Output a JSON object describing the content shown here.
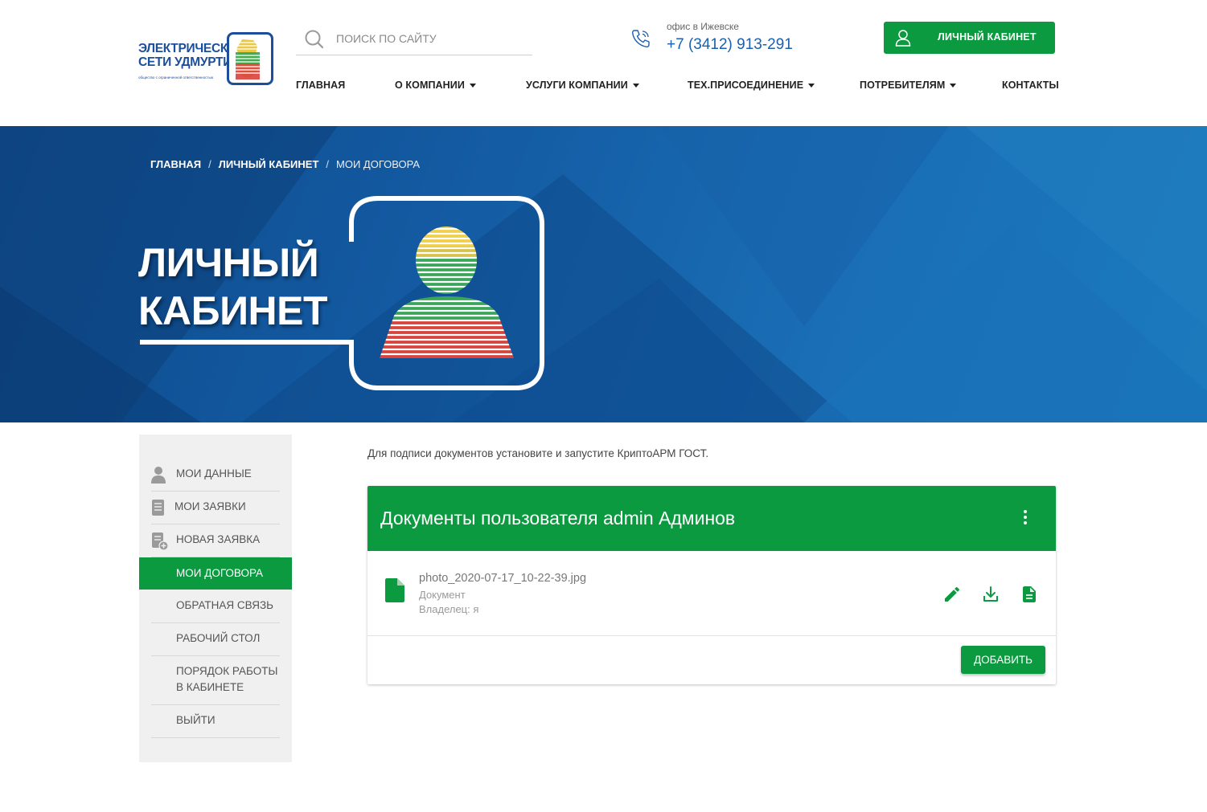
{
  "logo": {
    "line1": "ЭЛЕКТРИЧЕСКИЕ",
    "line2": "СЕТИ УДМУРТИИ",
    "subtitle": "общество с ограниченной ответственностью"
  },
  "search": {
    "placeholder": "ПОИСК ПО САЙТУ",
    "icon": "search-icon"
  },
  "contact": {
    "office_label": "офис в Ижевске",
    "phone": "+7 (3412) 913-291",
    "icon": "phone-icon"
  },
  "cabinet_button": {
    "label": "ЛИЧНЫЙ КАБИНЕТ",
    "icon": "user-icon"
  },
  "nav": [
    {
      "label": "ГЛАВНАЯ",
      "dropdown": false
    },
    {
      "label": "О КОМПАНИИ",
      "dropdown": true
    },
    {
      "label": "УСЛУГИ КОМПАНИИ",
      "dropdown": true
    },
    {
      "label": "ТЕХ.ПРИСОЕДИНЕНИЕ",
      "dropdown": true
    },
    {
      "label": "ПОТРЕБИТЕЛЯМ",
      "dropdown": true
    },
    {
      "label": "КОНТАКТЫ",
      "dropdown": false
    }
  ],
  "breadcrumb": {
    "home": "ГЛАВНАЯ",
    "cabinet": "ЛИЧНЫЙ КАБИНЕТ",
    "current": "МОИ ДОГОВОРА",
    "separator": "/"
  },
  "banner": {
    "title_line1": "ЛИЧНЫЙ",
    "title_line2": "КАБИНЕТ"
  },
  "sidebar": {
    "items": [
      {
        "label": "МОИ ДАННЫЕ",
        "icon": "user-icon",
        "active": false
      },
      {
        "label": "МОИ ЗАЯВКИ",
        "icon": "document-list-icon",
        "active": false
      },
      {
        "label": "НОВАЯ ЗАЯВКА",
        "icon": "document-add-icon",
        "active": false
      },
      {
        "label": "МОИ ДОГОВОРА",
        "icon": "",
        "active": true
      },
      {
        "label": "ОБРАТНАЯ СВЯЗЬ",
        "icon": "",
        "active": false
      },
      {
        "label": "РАБОЧИЙ СТОЛ",
        "icon": "",
        "active": false
      },
      {
        "label": "ПОРЯДОК РАБОТЫ В КАБИНЕТЕ",
        "line1": "ПОРЯДОК РАБОТЫ",
        "line2": "В КАБИНЕТЕ",
        "icon": "",
        "active": false
      },
      {
        "label": "ВЫЙТИ",
        "icon": "",
        "active": false
      }
    ]
  },
  "main": {
    "hint": "Для подписи документов установите и запустите КриптоАРМ ГОСТ.",
    "card": {
      "title": "Документы пользователя admin Админов",
      "file": {
        "name": "photo_2020-07-17_10-22-39.jpg",
        "type": "Документ",
        "owner": "Владелец: я"
      },
      "add_label": "ДОБАВИТЬ"
    }
  },
  "colors": {
    "brand_green": "#0b9a3f",
    "brand_blue": "#1b5fae",
    "banner_blue": "#135aa2"
  }
}
